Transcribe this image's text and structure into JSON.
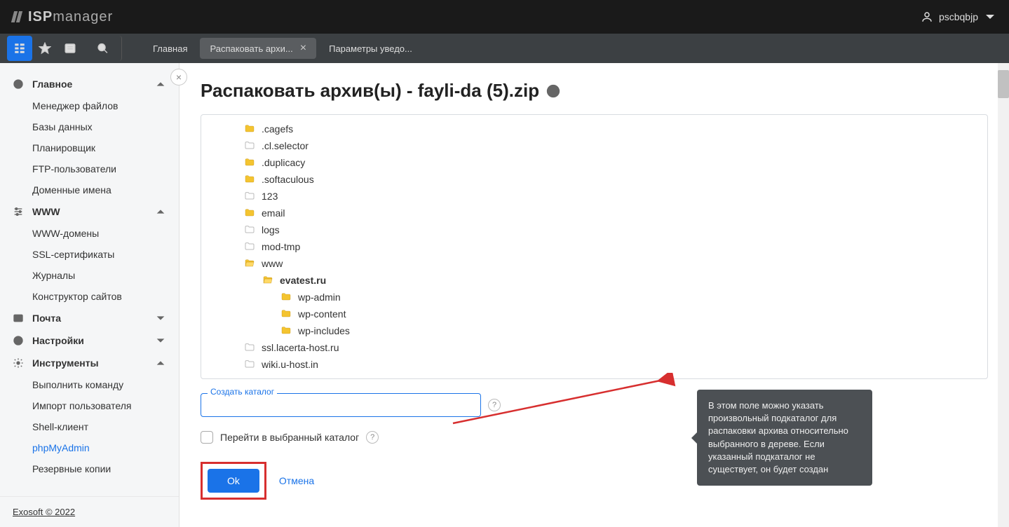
{
  "header": {
    "logo_pre": "ISP",
    "logo_post": "manager",
    "username": "pscbqbjp"
  },
  "tabbar": {
    "tabs": [
      {
        "label": "Главная",
        "active": false,
        "closable": false
      },
      {
        "label": "Распаковать архи...",
        "active": true,
        "closable": true
      },
      {
        "label": "Параметры уведо...",
        "active": false,
        "closable": false
      }
    ]
  },
  "sidebar": {
    "sections": [
      {
        "title": "Главное",
        "expanded": true,
        "icon": "dashboard",
        "items": [
          "Менеджер файлов",
          "Базы данных",
          "Планировщик",
          "FTP-пользователи",
          "Доменные имена"
        ]
      },
      {
        "title": "WWW",
        "expanded": true,
        "icon": "sliders",
        "items": [
          "WWW-домены",
          "SSL-сертификаты",
          "Журналы",
          "Конструктор сайтов"
        ]
      },
      {
        "title": "Почта",
        "expanded": false,
        "icon": "mail",
        "items": []
      },
      {
        "title": "Настройки",
        "expanded": false,
        "icon": "globe",
        "items": []
      },
      {
        "title": "Инструменты",
        "expanded": true,
        "icon": "gear",
        "items": [
          "Выполнить команду",
          "Импорт пользователя",
          "Shell-клиент",
          "phpMyAdmin",
          "Резервные копии"
        ]
      }
    ],
    "active_item": "phpMyAdmin",
    "footer": "Exosoft © 2022"
  },
  "page": {
    "title": "Распаковать архив(ы) - fayli-da (5).zip",
    "tree": [
      {
        "name": ".cagefs",
        "type": "folder",
        "indent": 1
      },
      {
        "name": ".cl.selector",
        "type": "folder-grey",
        "indent": 1
      },
      {
        "name": ".duplicacy",
        "type": "folder",
        "indent": 1
      },
      {
        "name": ".softaculous",
        "type": "folder",
        "indent": 1
      },
      {
        "name": "123",
        "type": "folder-grey",
        "indent": 1
      },
      {
        "name": "email",
        "type": "folder",
        "indent": 1
      },
      {
        "name": "logs",
        "type": "folder-grey",
        "indent": 1
      },
      {
        "name": "mod-tmp",
        "type": "folder-grey",
        "indent": 1
      },
      {
        "name": "www",
        "type": "folder-open",
        "indent": 1
      },
      {
        "name": "evatest.ru",
        "type": "folder-open",
        "indent": 2,
        "bold": true
      },
      {
        "name": "wp-admin",
        "type": "folder",
        "indent": 3
      },
      {
        "name": "wp-content",
        "type": "folder",
        "indent": 3
      },
      {
        "name": "wp-includes",
        "type": "folder",
        "indent": 3
      },
      {
        "name": "ssl.lacerta-host.ru",
        "type": "folder-grey",
        "indent": 1
      },
      {
        "name": "wiki.u-host.in",
        "type": "folder-grey",
        "indent": 1
      }
    ],
    "create_dir_label": "Создать каталог",
    "create_dir_value": "",
    "checkbox_label": "Перейти в выбранный каталог",
    "tooltip_text": "В этом поле можно указать произвольный подкаталог для распаковки архива относительно выбранного в дереве. Если указанный подкаталог не существует, он будет создан",
    "btn_ok": "Ok",
    "btn_cancel": "Отмена"
  }
}
